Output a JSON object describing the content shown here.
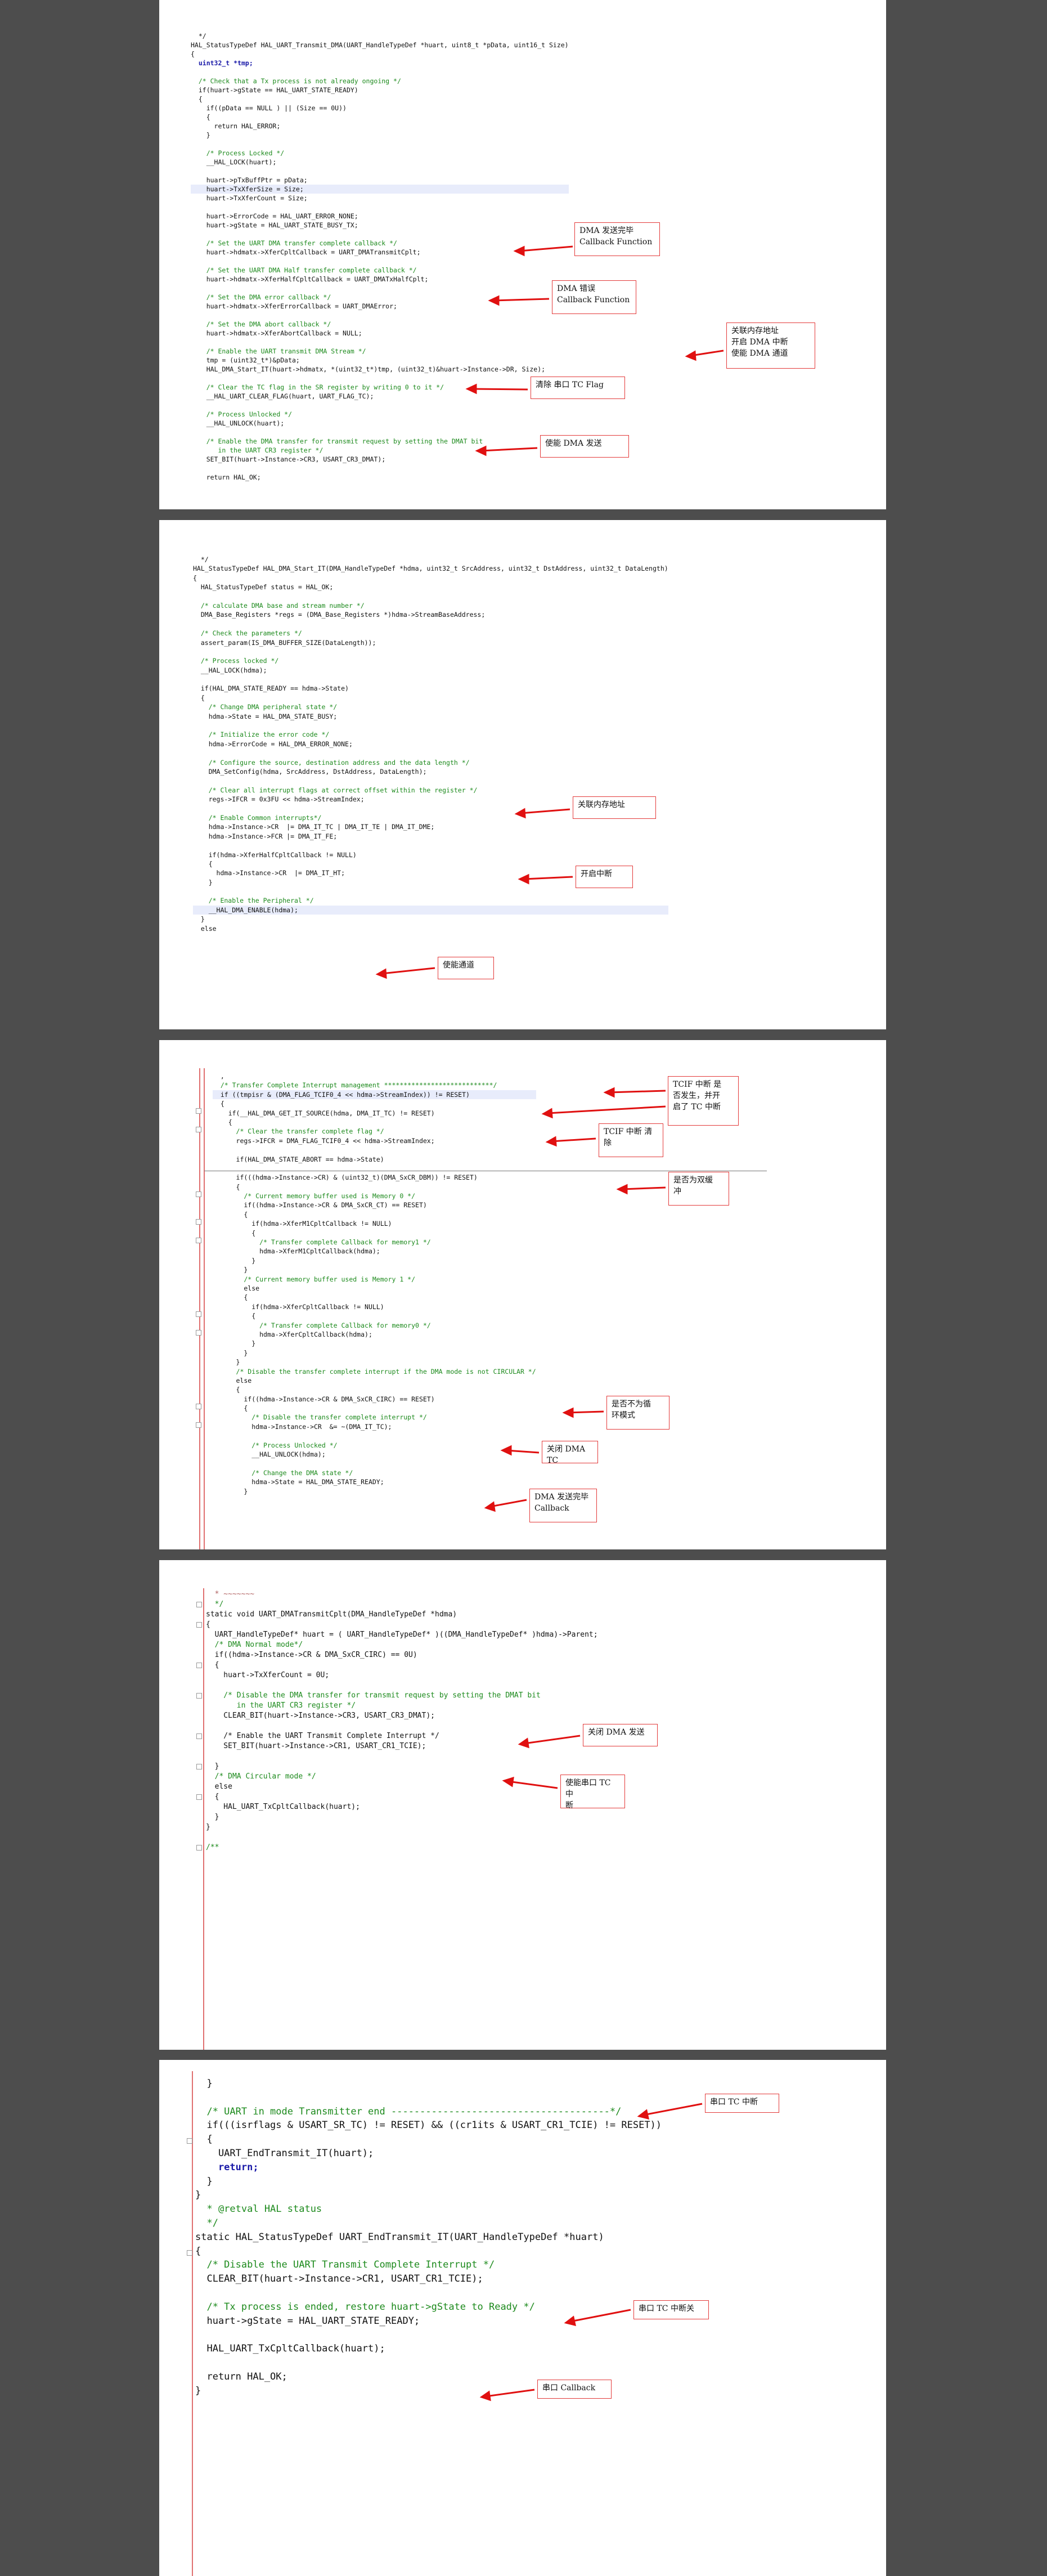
{
  "pages": [
    {
      "code": [
        {
          "t": "  */"
        },
        {
          "t": "HAL_StatusTypeDef HAL_UART_Transmit_DMA(UART_HandleTypeDef *huart, uint8_t *pData, uint16_t Size)"
        },
        {
          "t": "{"
        },
        {
          "t": "  uint32_t *tmp;",
          "c": "kw"
        },
        {
          "t": ""
        },
        {
          "t": "  /* Check that a Tx process is not already ongoing */",
          "c": "cm"
        },
        {
          "t": "  if(huart->gState == HAL_UART_STATE_READY)"
        },
        {
          "t": "  {"
        },
        {
          "t": "    if((pData == NULL ) || (Size == 0U))"
        },
        {
          "t": "    {"
        },
        {
          "t": "      return HAL_ERROR;"
        },
        {
          "t": "    }"
        },
        {
          "t": ""
        },
        {
          "t": "    /* Process Locked */",
          "c": "cm"
        },
        {
          "t": "    __HAL_LOCK(huart);"
        },
        {
          "t": ""
        },
        {
          "t": "    huart->pTxBuffPtr = pData;"
        },
        {
          "t": "    huart->TxXferSize = Size;",
          "c": "hl"
        },
        {
          "t": "    huart->TxXferCount = Size;"
        },
        {
          "t": ""
        },
        {
          "t": "    huart->ErrorCode = HAL_UART_ERROR_NONE;"
        },
        {
          "t": "    huart->gState = HAL_UART_STATE_BUSY_TX;"
        },
        {
          "t": ""
        },
        {
          "t": "    /* Set the UART DMA transfer complete callback */",
          "c": "cm"
        },
        {
          "t": "    huart->hdmatx->XferCpltCallback = UART_DMATransmitCplt;"
        },
        {
          "t": ""
        },
        {
          "t": "    /* Set the UART DMA Half transfer complete callback */",
          "c": "cm"
        },
        {
          "t": "    huart->hdmatx->XferHalfCpltCallback = UART_DMATxHalfCplt;"
        },
        {
          "t": ""
        },
        {
          "t": "    /* Set the DMA error callback */",
          "c": "cm"
        },
        {
          "t": "    huart->hdmatx->XferErrorCallback = UART_DMAError;"
        },
        {
          "t": ""
        },
        {
          "t": "    /* Set the DMA abort callback */",
          "c": "cm"
        },
        {
          "t": "    huart->hdmatx->XferAbortCallback = NULL;"
        },
        {
          "t": ""
        },
        {
          "t": "    /* Enable the UART transmit DMA Stream */",
          "c": "cm"
        },
        {
          "t": "    tmp = (uint32_t*)&pData;"
        },
        {
          "t": "    HAL_DMA_Start_IT(huart->hdmatx, *(uint32_t*)tmp, (uint32_t)&huart->Instance->DR, Size);"
        },
        {
          "t": ""
        },
        {
          "t": "    /* Clear the TC flag in the SR register by writing 0 to it */",
          "c": "cm"
        },
        {
          "t": "    __HAL_UART_CLEAR_FLAG(huart, UART_FLAG_TC);"
        },
        {
          "t": ""
        },
        {
          "t": "    /* Process Unlocked */",
          "c": "cm"
        },
        {
          "t": "    __HAL_UNLOCK(huart);"
        },
        {
          "t": ""
        },
        {
          "t": "    /* Enable the DMA transfer for transmit request by setting the DMAT bit",
          "c": "cm"
        },
        {
          "t": "       in the UART CR3 register */",
          "c": "cm"
        },
        {
          "t": "    SET_BIT(huart->Instance->CR3, USART_CR3_DMAT);"
        },
        {
          "t": ""
        },
        {
          "t": "    return HAL_OK;"
        }
      ],
      "notes": [
        "DMA 发送完毕\nCallback Function",
        "DMA 错误\nCallback Function",
        "关联内存地址\n开启 DMA 中断\n使能 DMA 通道",
        "清除 串口 TC Flag",
        "使能 DMA 发送"
      ]
    },
    {
      "code": [
        {
          "t": "  */"
        },
        {
          "t": "HAL_StatusTypeDef HAL_DMA_Start_IT(DMA_HandleTypeDef *hdma, uint32_t SrcAddress, uint32_t DstAddress, uint32_t DataLength)"
        },
        {
          "t": "{"
        },
        {
          "t": "  HAL_StatusTypeDef status = HAL_OK;"
        },
        {
          "t": ""
        },
        {
          "t": "  /* calculate DMA base and stream number */",
          "c": "cm"
        },
        {
          "t": "  DMA_Base_Registers *regs = (DMA_Base_Registers *)hdma->StreamBaseAddress;"
        },
        {
          "t": ""
        },
        {
          "t": "  /* Check the parameters */",
          "c": "cm"
        },
        {
          "t": "  assert_param(IS_DMA_BUFFER_SIZE(DataLength));"
        },
        {
          "t": ""
        },
        {
          "t": "  /* Process locked */",
          "c": "cm"
        },
        {
          "t": "  __HAL_LOCK(hdma);"
        },
        {
          "t": ""
        },
        {
          "t": "  if(HAL_DMA_STATE_READY == hdma->State)"
        },
        {
          "t": "  {"
        },
        {
          "t": "    /* Change DMA peripheral state */",
          "c": "cm"
        },
        {
          "t": "    hdma->State = HAL_DMA_STATE_BUSY;"
        },
        {
          "t": ""
        },
        {
          "t": "    /* Initialize the error code */",
          "c": "cm"
        },
        {
          "t": "    hdma->ErrorCode = HAL_DMA_ERROR_NONE;"
        },
        {
          "t": ""
        },
        {
          "t": "    /* Configure the source, destination address and the data length */",
          "c": "cm"
        },
        {
          "t": "    DMA_SetConfig(hdma, SrcAddress, DstAddress, DataLength);"
        },
        {
          "t": ""
        },
        {
          "t": "    /* Clear all interrupt flags at correct offset within the register */",
          "c": "cm"
        },
        {
          "t": "    regs->IFCR = 0x3FU << hdma->StreamIndex;"
        },
        {
          "t": ""
        },
        {
          "t": "    /* Enable Common interrupts*/",
          "c": "cm"
        },
        {
          "t": "    hdma->Instance->CR  |= DMA_IT_TC | DMA_IT_TE | DMA_IT_DME;"
        },
        {
          "t": "    hdma->Instance->FCR |= DMA_IT_FE;"
        },
        {
          "t": ""
        },
        {
          "t": "    if(hdma->XferHalfCpltCallback != NULL)"
        },
        {
          "t": "    {"
        },
        {
          "t": "      hdma->Instance->CR  |= DMA_IT_HT;"
        },
        {
          "t": "    }"
        },
        {
          "t": ""
        },
        {
          "t": "    /* Enable the Peripheral */",
          "c": "cm"
        },
        {
          "t": "    __HAL_DMA_ENABLE(hdma);",
          "c": "hl"
        },
        {
          "t": "  }"
        },
        {
          "t": "  else"
        }
      ],
      "notes": [
        "关联内存地址",
        "开启中断",
        "使能通道"
      ]
    },
    {
      "code": [
        {
          "t": "  ,"
        },
        {
          "t": "  /* Transfer Complete Interrupt management ****************************/",
          "c": "cm"
        },
        {
          "t": "  if ((tmpisr & (DMA_FLAG_TCIF0_4 << hdma->StreamIndex)) != RESET)",
          "c": "hl"
        },
        {
          "t": "  {"
        },
        {
          "t": "    if(__HAL_DMA_GET_IT_SOURCE(hdma, DMA_IT_TC) != RESET)"
        },
        {
          "t": "    {"
        },
        {
          "t": "      /* Clear the transfer complete flag */",
          "c": "cm"
        },
        {
          "t": "      regs->IFCR = DMA_FLAG_TCIF0_4 << hdma->StreamIndex;"
        },
        {
          "t": ""
        },
        {
          "t": "      if(HAL_DMA_STATE_ABORT == hdma->State)"
        },
        {
          "t": ""
        },
        {
          "t": "      if(((hdma->Instance->CR) & (uint32_t)(DMA_SxCR_DBM)) != RESET)"
        },
        {
          "t": "      {"
        },
        {
          "t": "        /* Current memory buffer used is Memory 0 */",
          "c": "cm"
        },
        {
          "t": "        if((hdma->Instance->CR & DMA_SxCR_CT) == RESET)"
        },
        {
          "t": "        {"
        },
        {
          "t": "          if(hdma->XferM1CpltCallback != NULL)"
        },
        {
          "t": "          {"
        },
        {
          "t": "            /* Transfer complete Callback for memory1 */",
          "c": "cm"
        },
        {
          "t": "            hdma->XferM1CpltCallback(hdma);"
        },
        {
          "t": "          }"
        },
        {
          "t": "        }"
        },
        {
          "t": "        /* Current memory buffer used is Memory 1 */",
          "c": "cm"
        },
        {
          "t": "        else"
        },
        {
          "t": "        {"
        },
        {
          "t": "          if(hdma->XferCpltCallback != NULL)"
        },
        {
          "t": "          {"
        },
        {
          "t": "            /* Transfer complete Callback for memory0 */",
          "c": "cm"
        },
        {
          "t": "            hdma->XferCpltCallback(hdma);"
        },
        {
          "t": "          }"
        },
        {
          "t": "        }"
        },
        {
          "t": "      }"
        },
        {
          "t": "      /* Disable the transfer complete interrupt if the DMA mode is not CIRCULAR */",
          "c": "cm"
        },
        {
          "t": "      else"
        },
        {
          "t": "      {"
        },
        {
          "t": "        if((hdma->Instance->CR & DMA_SxCR_CIRC) == RESET)"
        },
        {
          "t": "        {"
        },
        {
          "t": "          /* Disable the transfer complete interrupt */",
          "c": "cm"
        },
        {
          "t": "          hdma->Instance->CR  &= ~(DMA_IT_TC);"
        },
        {
          "t": ""
        },
        {
          "t": "          /* Process Unlocked */",
          "c": "cm"
        },
        {
          "t": "          __HAL_UNLOCK(hdma);"
        },
        {
          "t": ""
        },
        {
          "t": "          /* Change the DMA state */",
          "c": "cm"
        },
        {
          "t": "          hdma->State = HAL_DMA_STATE_READY;"
        },
        {
          "t": "        }"
        }
      ],
      "notes": [
        "TCIF 中断 是\n否发生，并开\n启了 TC 中断",
        "TCIF 中断 清\n除",
        "是否为双缓\n冲",
        "是否不为循\n环模式",
        "关闭 DMA TC",
        "DMA 发送完毕\nCallback"
      ]
    },
    {
      "code": [
        {
          "t": "  * ~~~~~~~",
          "c": "dec"
        },
        {
          "t": "  */",
          "c": "cm"
        },
        {
          "t": "static void UART_DMATransmitCplt(DMA_HandleTypeDef *hdma)"
        },
        {
          "t": "{"
        },
        {
          "t": "  UART_HandleTypeDef* huart = ( UART_HandleTypeDef* )((DMA_HandleTypeDef* )hdma)->Parent;"
        },
        {
          "t": "  /* DMA Normal mode*/",
          "c": "cm"
        },
        {
          "t": "  if((hdma->Instance->CR & DMA_SxCR_CIRC) == 0U)"
        },
        {
          "t": "  {"
        },
        {
          "t": "    huart->TxXferCount = 0U;"
        },
        {
          "t": ""
        },
        {
          "t": "    /* Disable the DMA transfer for transmit request by setting the DMAT bit",
          "c": "cm"
        },
        {
          "t": "       in the UART CR3 register */",
          "c": "cm"
        },
        {
          "t": "    CLEAR_BIT(huart->Instance->CR3, USART_CR3_DMAT);"
        },
        {
          "t": ""
        },
        {
          "t": "    /* Enable the UART Transmit Complete Interrupt */",
          "c": "cur"
        },
        {
          "t": "    SET_BIT(huart->Instance->CR1, USART_CR1_TCIE);"
        },
        {
          "t": ""
        },
        {
          "t": "  }"
        },
        {
          "t": "  /* DMA Circular mode */",
          "c": "cm"
        },
        {
          "t": "  else"
        },
        {
          "t": "  {"
        },
        {
          "t": "    HAL_UART_TxCpltCallback(huart);"
        },
        {
          "t": "  }"
        },
        {
          "t": "}"
        },
        {
          "t": ""
        },
        {
          "t": "/**",
          "c": "cm"
        }
      ],
      "notes": [
        "关闭 DMA 发送",
        "使能串口 TC 中\n断"
      ]
    },
    {
      "code": [
        {
          "t": "  }"
        },
        {
          "t": ""
        },
        {
          "t": "  /* UART in mode Transmitter end --------------------------------------*/",
          "c": "cm"
        },
        {
          "t": "  if(((isrflags & USART_SR_TC) != RESET) && ((cr1its & USART_CR1_TCIE) != RESET))"
        },
        {
          "t": "  {"
        },
        {
          "t": "    UART_EndTransmit_IT(huart);"
        },
        {
          "t": "    return;",
          "c": "kw"
        },
        {
          "t": "  }"
        },
        {
          "t": "}"
        },
        {
          "t": "  * @retval HAL status",
          "c": "cm"
        },
        {
          "t": "  */",
          "c": "cm"
        },
        {
          "t": "static HAL_StatusTypeDef UART_EndTransmit_IT(UART_HandleTypeDef *huart)"
        },
        {
          "t": "{"
        },
        {
          "t": "  /* Disable the UART Transmit Complete Interrupt */",
          "c": "cm"
        },
        {
          "t": "  CLEAR_BIT(huart->Instance->CR1, USART_CR1_TCIE);"
        },
        {
          "t": ""
        },
        {
          "t": "  /* Tx process is ended, restore huart->gState to Ready */",
          "c": "cm"
        },
        {
          "t": "  huart->gState = HAL_UART_STATE_READY;"
        },
        {
          "t": ""
        },
        {
          "t": "  HAL_UART_TxCpltCallback(huart);"
        },
        {
          "t": ""
        },
        {
          "t": "  return HAL_OK;"
        },
        {
          "t": "}"
        }
      ],
      "notes": [
        "串口 TC 中断",
        "串口 TC 中断关",
        "串口 Callback"
      ]
    }
  ]
}
